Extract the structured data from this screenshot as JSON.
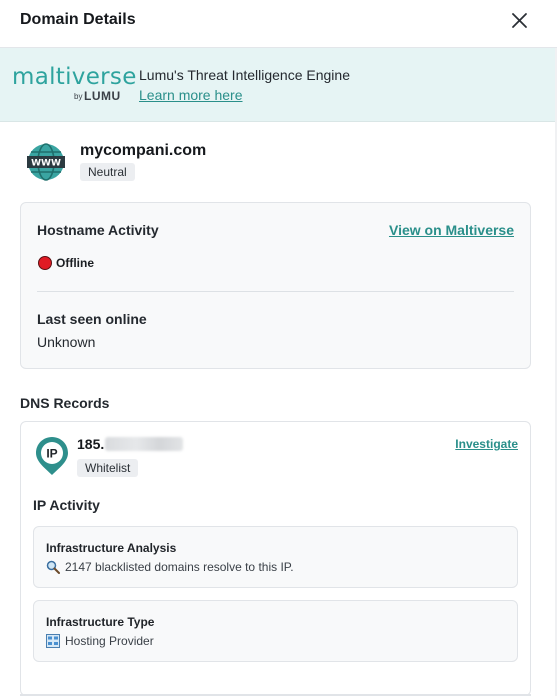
{
  "header": {
    "title": "Domain Details"
  },
  "banner": {
    "logo_word": "maltiverse",
    "logo_by": "by",
    "logo_brand": "LUMU",
    "title": "Lumu's Threat Intelligence Engine",
    "link": "Learn more here"
  },
  "domain": {
    "name": "mycompani.com",
    "badge": "Neutral"
  },
  "hostname_card": {
    "title": "Hostname Activity",
    "link": "View on Maltiverse",
    "status": "Offline",
    "status_color": "#e01b24",
    "last_seen_label": "Last seen online",
    "last_seen_value": "Unknown"
  },
  "dns": {
    "section_title": "DNS Records",
    "ip_prefix": "185.",
    "ip_badge": "Whitelist",
    "investigate_link": "Investigate",
    "activity_title": "IP Activity",
    "analysis": {
      "title": "Infrastructure Analysis",
      "icon": "magnifier-icon",
      "text": "2147 blacklisted domains resolve to this IP."
    },
    "type": {
      "title": "Infrastructure Type",
      "icon": "server-icon",
      "text": "Hosting Provider"
    }
  },
  "colors": {
    "accent": "#2a8f8a",
    "banner_bg": "#e6f4f4"
  }
}
